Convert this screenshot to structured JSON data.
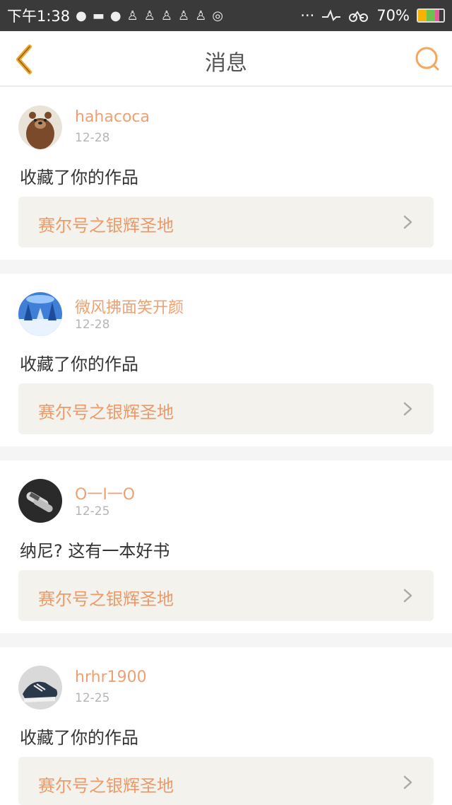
{
  "status_bar": {
    "time": "下午1:38",
    "left_icons": [
      "wechat-icon",
      "message-icon",
      "wechat-icon",
      "bowling-icon",
      "bowling-icon",
      "bowling-icon",
      "bowling-icon",
      "bowling-icon",
      "ring-icon"
    ],
    "dots": "···",
    "battery_percent": "70%",
    "battery_level": 0.7
  },
  "header": {
    "title": "消息",
    "back_icon": "back-chevron-icon",
    "search_icon": "search-icon",
    "accent_color": "#f5a623"
  },
  "messages": [
    {
      "username": "hahacoca",
      "date": "12-28",
      "message": "收藏了你的作品",
      "work_title": "赛尔号之银辉圣地",
      "avatar": "bear-avatar"
    },
    {
      "username": "微风拂面笑开颜",
      "date": "12-28",
      "message": "收藏了你的作品",
      "work_title": "赛尔号之银辉圣地",
      "avatar": "snow-forest-avatar"
    },
    {
      "username": "O一I一O",
      "date": "12-25",
      "message": "纳尼? 这有一本好书",
      "work_title": "赛尔号之银辉圣地",
      "avatar": "hand-avatar"
    },
    {
      "username": "hrhr1900",
      "date": "12-25",
      "message": "收藏了你的作品",
      "work_title": "赛尔号之银辉圣地",
      "avatar": "sneaker-avatar"
    }
  ]
}
